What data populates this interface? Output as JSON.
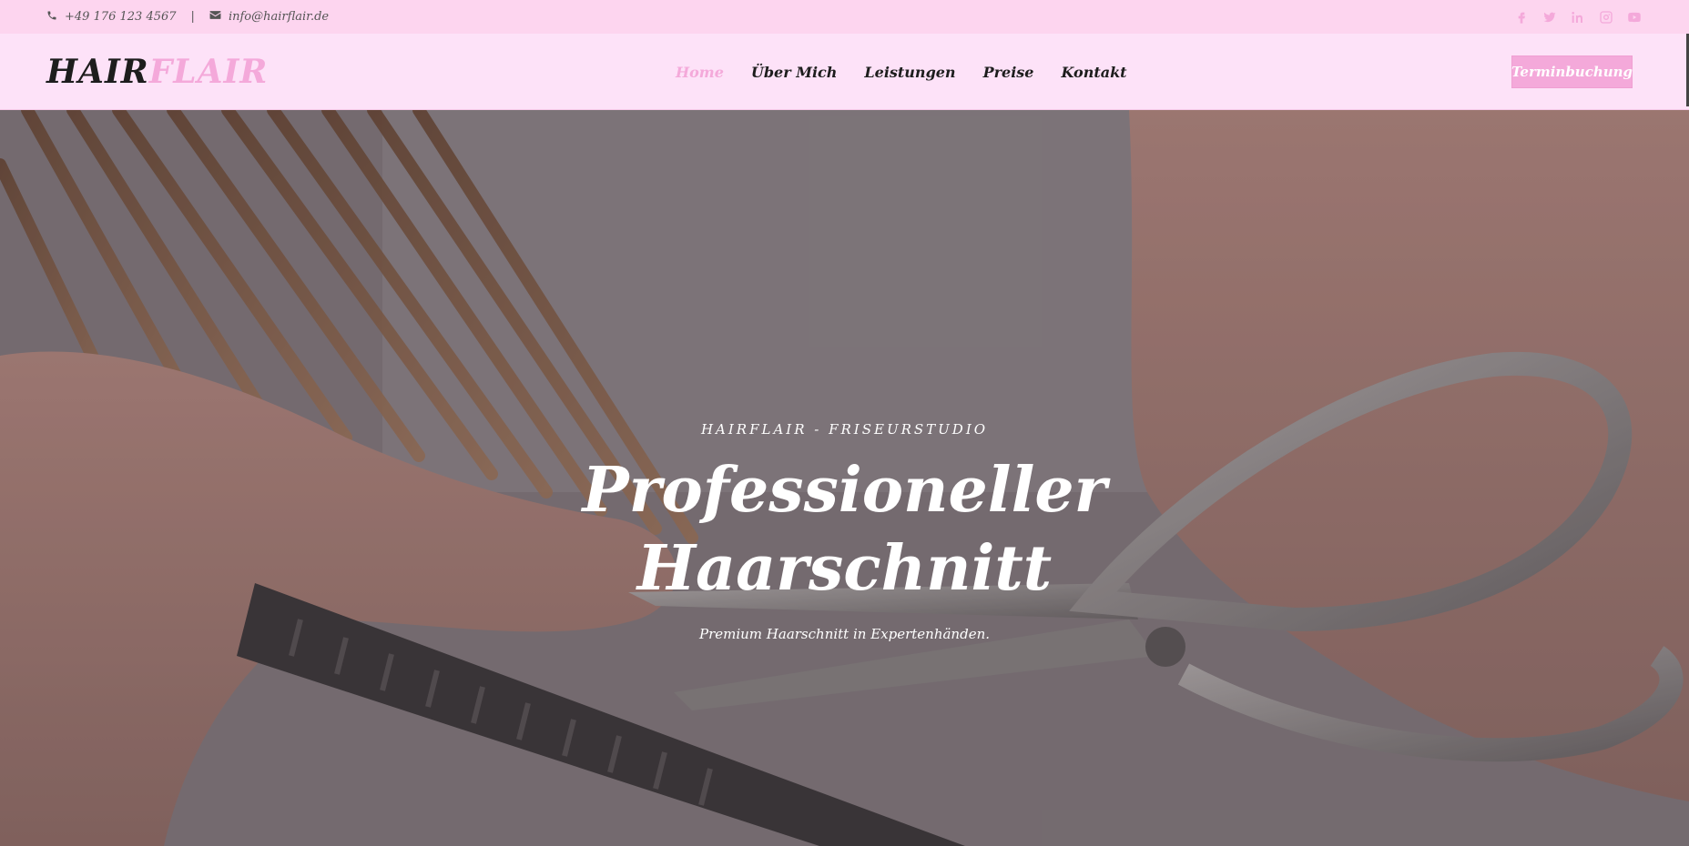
{
  "topbar": {
    "phone": "+49 176 123 4567",
    "separator": "|",
    "email": "info@hairflair.de",
    "socials": [
      "facebook-icon",
      "twitter-icon",
      "linkedin-icon",
      "instagram-icon",
      "youtube-icon"
    ]
  },
  "header": {
    "logo_part1": "HAIR",
    "logo_part2": "FLAIR",
    "nav": [
      "Home",
      "Über Mich",
      "Leistungen",
      "Preise",
      "Kontakt"
    ],
    "active_nav": "Home",
    "cta": "Terminbuchung"
  },
  "hero": {
    "eyebrow": "HAIRFLAIR - FRISEURSTUDIO",
    "headline_line1": "Professioneller",
    "headline_line2": "Haarschnitt",
    "tagline": "Premium Haarschnitt in Expertenhänden."
  },
  "colors": {
    "accent": "#f4a9da",
    "topbar_bg": "#fdd5ef",
    "header_bg": "#fde2f8",
    "text_dark": "#1d1d1d"
  }
}
